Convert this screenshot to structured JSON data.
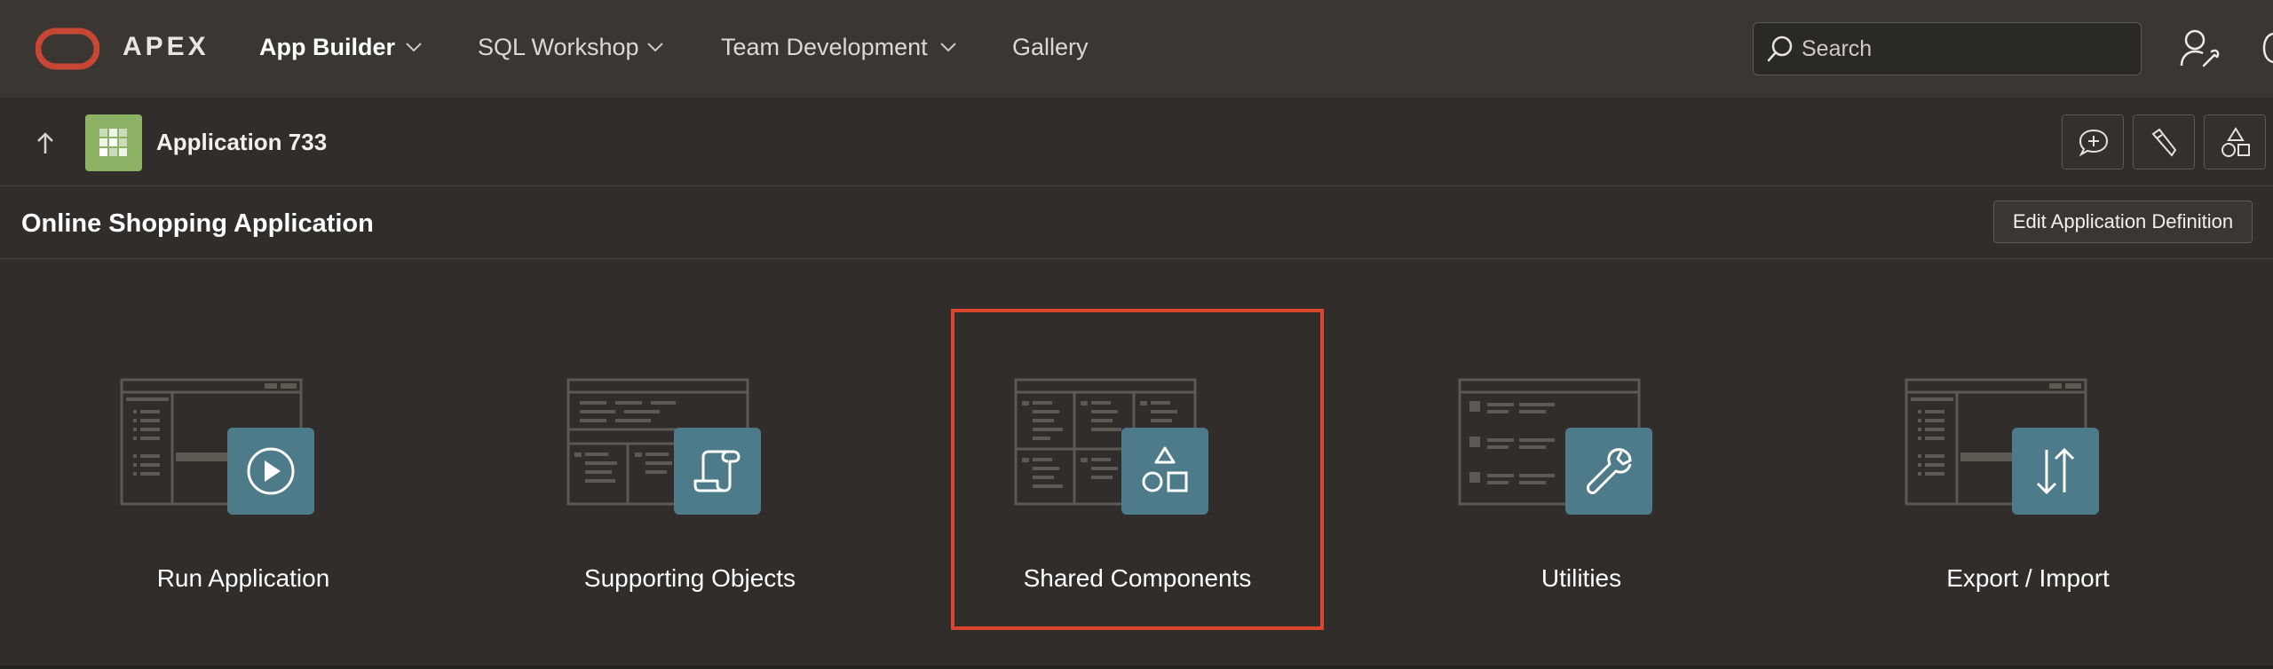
{
  "brand": {
    "name": "APEX",
    "logo_icon": "oracle-logo-icon",
    "logo_color": "#c74634"
  },
  "nav": {
    "items": [
      {
        "label": "App Builder",
        "active": true,
        "has_menu": true
      },
      {
        "label": "SQL Workshop",
        "active": false,
        "has_menu": true
      },
      {
        "label": "Team Development",
        "active": false,
        "has_menu": true
      },
      {
        "label": "Gallery",
        "active": false,
        "has_menu": false
      }
    ]
  },
  "search": {
    "placeholder": "Search",
    "icon": "search-icon"
  },
  "user_menu": {
    "icon": "user-settings-icon"
  },
  "app_bar": {
    "title": "Application 733",
    "icon": "application-grid-icon",
    "icon_color": "#8cb266",
    "tools": [
      "feedback-icon",
      "utilities-icon",
      "shared-components-icon"
    ]
  },
  "page": {
    "title": "Online Shopping Application",
    "edit_button": "Edit Application Definition"
  },
  "tiles": [
    {
      "label": "Run Application",
      "icon": "play-icon",
      "selected": false
    },
    {
      "label": "Supporting Objects",
      "icon": "scroll-icon",
      "selected": false
    },
    {
      "label": "Shared Components",
      "icon": "shapes-icon",
      "selected": true
    },
    {
      "label": "Utilities",
      "icon": "wrench-icon",
      "selected": false
    },
    {
      "label": "Export / Import",
      "icon": "up-down-arrows-icon",
      "selected": false
    }
  ],
  "colors": {
    "background": "#302d2a",
    "topbar": "#3a3733",
    "badge": "#4d7b8a",
    "selection": "#d9452e"
  }
}
